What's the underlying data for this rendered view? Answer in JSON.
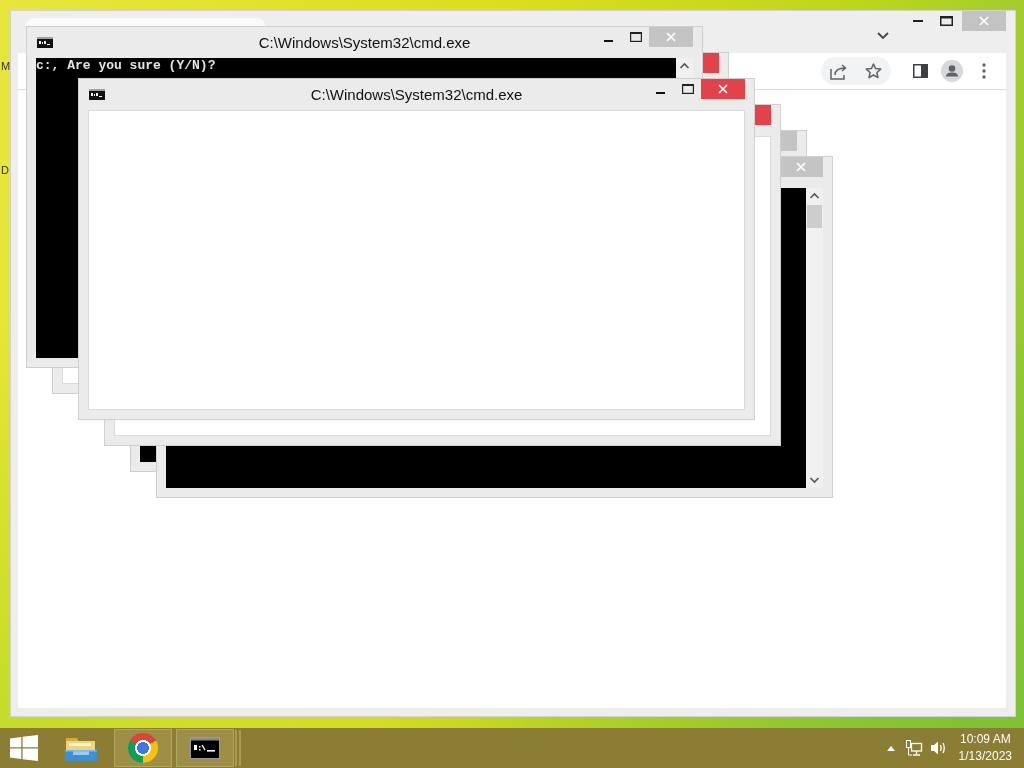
{
  "desktop_labels": [
    "M",
    "D"
  ],
  "cmd_windows": [
    {
      "title": "C:\\Windows\\System32\\cmd.exe",
      "active": false,
      "kind": "console",
      "console_lines": [
        "c:, Are you sure (Y/N)?"
      ]
    },
    {
      "active": true,
      "kind": "blank"
    },
    {
      "title": "C:\\Windows\\System32\\cmd.exe",
      "active": true,
      "kind": "blank"
    },
    {
      "active": true,
      "kind": "blank"
    },
    {
      "active": false,
      "kind": "console"
    },
    {
      "active": false,
      "kind": "console"
    }
  ],
  "taskbar": {
    "apps": [
      {
        "kind": "folder",
        "running": false,
        "stacked": false
      },
      {
        "kind": "browser",
        "running": true,
        "stacked": false
      },
      {
        "kind": "console",
        "running": true,
        "stacked": true
      }
    ],
    "clock": {
      "time": "10:09 AM",
      "date": "1/13/2023"
    }
  }
}
